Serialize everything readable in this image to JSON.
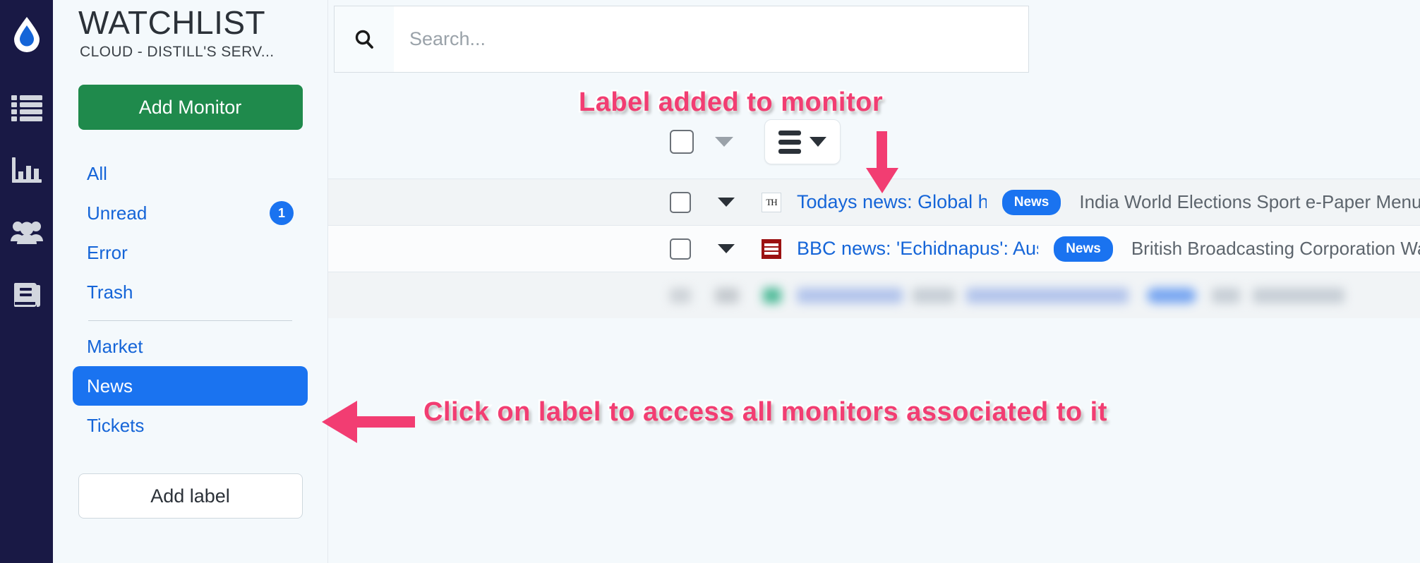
{
  "rail": {
    "logo_icon": "distill-droplet-logo",
    "items": [
      {
        "icon": "list-icon",
        "name": "monitors"
      },
      {
        "icon": "bar-chart-icon",
        "name": "analytics"
      },
      {
        "icon": "people-icon",
        "name": "team"
      },
      {
        "icon": "book-icon",
        "name": "docs"
      }
    ]
  },
  "sidebar": {
    "title": "WATCHLIST",
    "subtitle": "CLOUD - DISTILL'S SERV...",
    "add_monitor_label": "Add Monitor",
    "add_label_label": "Add label",
    "nav": [
      {
        "label": "All",
        "badge": "",
        "active": false
      },
      {
        "label": "Unread",
        "badge": "1",
        "active": false
      },
      {
        "label": "Error",
        "badge": "",
        "active": false
      },
      {
        "label": "Trash",
        "badge": "",
        "active": false
      }
    ],
    "labels": [
      {
        "label": "Market",
        "active": false
      },
      {
        "label": "News",
        "active": true
      },
      {
        "label": "Tickets",
        "active": false
      }
    ]
  },
  "search": {
    "placeholder": "Search...",
    "value": "",
    "icon": "search-icon"
  },
  "toolbar": {
    "select_all_checkbox": "",
    "select_caret_icon": "chevron-down-icon",
    "menu_icon": "hamburger-icon",
    "menu_caret_icon": "chevron-down-icon"
  },
  "rows": [
    {
      "favicon": "TH",
      "favicon_type": "th",
      "title": "Todays news: Global heatwaves",
      "pill": "News",
      "description": "India World Elections Sport e-Paper Menu Visual Story Data"
    },
    {
      "favicon": "BBC",
      "favicon_type": "bbc",
      "title": "BBC news: 'Echidnapus': Australian scientists dis",
      "pill": "News",
      "description": "British Broadcasting Corporation Watch Live Register Sign In"
    }
  ],
  "annotations": [
    {
      "text": "Label added to monitor",
      "arrow": "arrow-down"
    },
    {
      "text": "Click on label to access all monitors associated to it",
      "arrow": "arrow-left"
    }
  ],
  "colors": {
    "rail_bg": "#191945",
    "sidebar_bg": "#f4f9fc",
    "accent_blue": "#1a73f0",
    "link_blue": "#1565d8",
    "green": "#1f8a4c",
    "annotation_pink": "#f23d72"
  }
}
